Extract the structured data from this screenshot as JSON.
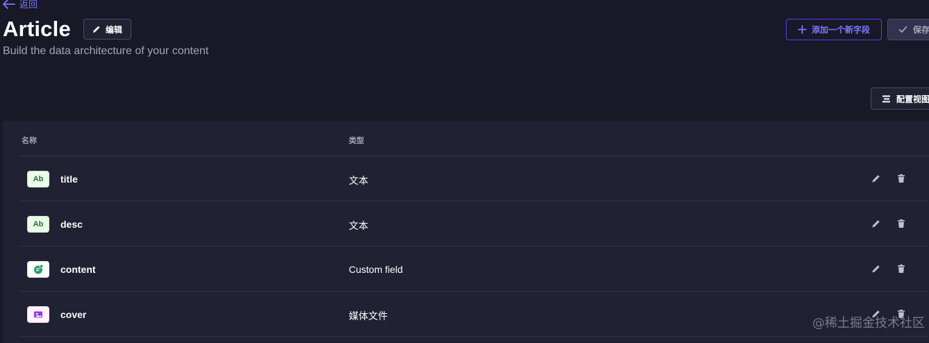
{
  "header": {
    "back_label": "返回",
    "title": "Article",
    "edit_label": "编辑",
    "subtitle": "Build the data architecture of your content"
  },
  "actions": {
    "add_field_label": "添加一个新字段",
    "save_label": "保存",
    "configure_view_label": "配置视图"
  },
  "table": {
    "columns": {
      "name": "名称",
      "type": "类型"
    },
    "rows": [
      {
        "icon": "text-field-icon",
        "icon_text": "Ab",
        "name": "title",
        "type": "文本"
      },
      {
        "icon": "text-field-icon",
        "icon_text": "Ab",
        "name": "desc",
        "type": "文本"
      },
      {
        "icon": "custom-field-icon",
        "icon_text": "",
        "name": "content",
        "type": "Custom field"
      },
      {
        "icon": "media-field-icon",
        "icon_text": "",
        "name": "cover",
        "type": "媒体文件"
      }
    ]
  },
  "watermark": "@稀土掘金技术社区",
  "colors": {
    "background": "#181826",
    "card": "#212134",
    "accent": "#7b79ff",
    "text_icon_bg": "#eafbe7",
    "media_icon": "#9736e8",
    "custom_icon": "#1fa26f"
  }
}
